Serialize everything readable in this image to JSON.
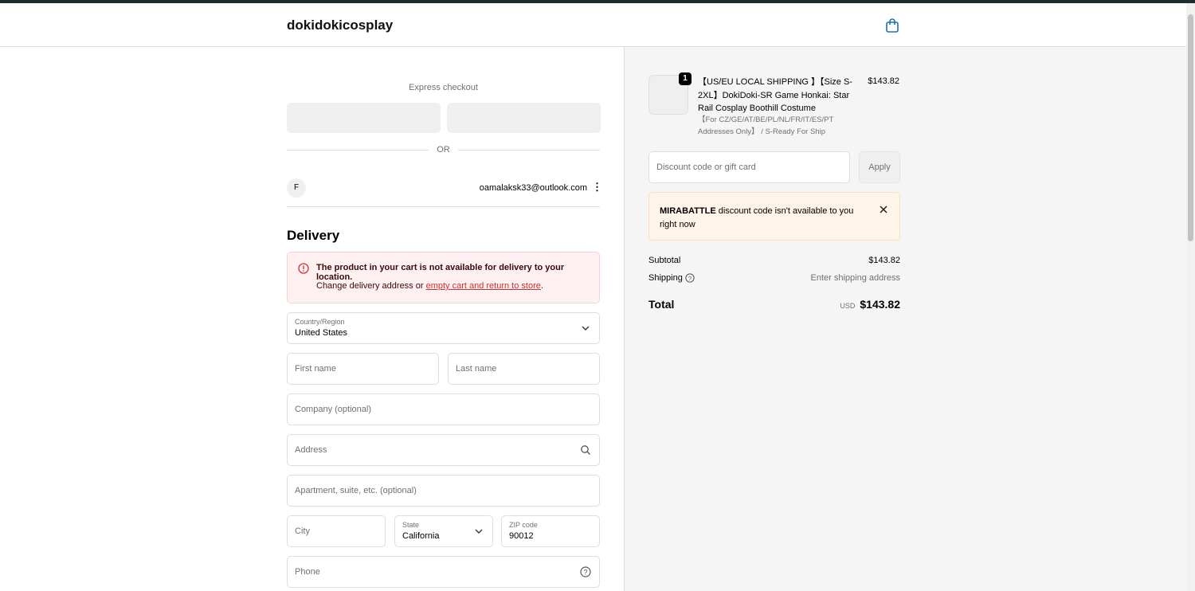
{
  "header": {
    "store_name": "dokidokicosplay",
    "cart_icon": "shopping-bag-icon"
  },
  "express": {
    "title": "Express checkout",
    "divider": "OR"
  },
  "account": {
    "avatar_initial": "F",
    "email": "oamalaksk33@outlook.com"
  },
  "delivery": {
    "title": "Delivery",
    "error": {
      "title": "The product in your cart is not available for delivery to your location.",
      "text_before": "Change delivery address or ",
      "link": "empty cart and return to store",
      "text_after": "."
    },
    "country": {
      "label": "Country/Region",
      "value": "United States"
    },
    "first_name": {
      "placeholder": "First name"
    },
    "last_name": {
      "placeholder": "Last name"
    },
    "company": {
      "placeholder": "Company (optional)"
    },
    "address": {
      "placeholder": "Address"
    },
    "apartment": {
      "placeholder": "Apartment, suite, etc. (optional)"
    },
    "city": {
      "placeholder": "City"
    },
    "state": {
      "label": "State",
      "value": "California"
    },
    "zip": {
      "label": "ZIP code",
      "value": "90012"
    },
    "phone": {
      "placeholder": "Phone"
    }
  },
  "summary": {
    "item": {
      "quantity": "1",
      "title": "【US/EU LOCAL SHIPPING 】【Size S-2XL】DokiDoki-SR Game Honkai: Star Rail Cosplay Boothill Costume",
      "variant": "【For CZ/GE/AT/BE/PL/NL/FR/IT/ES/PT Addresses Only】 / S-Ready For Ship",
      "price": "$143.82"
    },
    "discount": {
      "placeholder": "Discount code or gift card",
      "apply": "Apply"
    },
    "notice": {
      "code": "MIRABATTLE",
      "text": " discount code isn't available to you right now"
    },
    "subtotal_label": "Subtotal",
    "subtotal": "$143.82",
    "shipping_label": "Shipping",
    "shipping": "Enter shipping address",
    "total_label": "Total",
    "currency": "USD",
    "total": "$143.82"
  },
  "colors": {
    "error_bg": "#fff1f1",
    "error_text": "#8e1f0b",
    "link": "#d32f2f",
    "notice_bg": "#fff4e8"
  }
}
